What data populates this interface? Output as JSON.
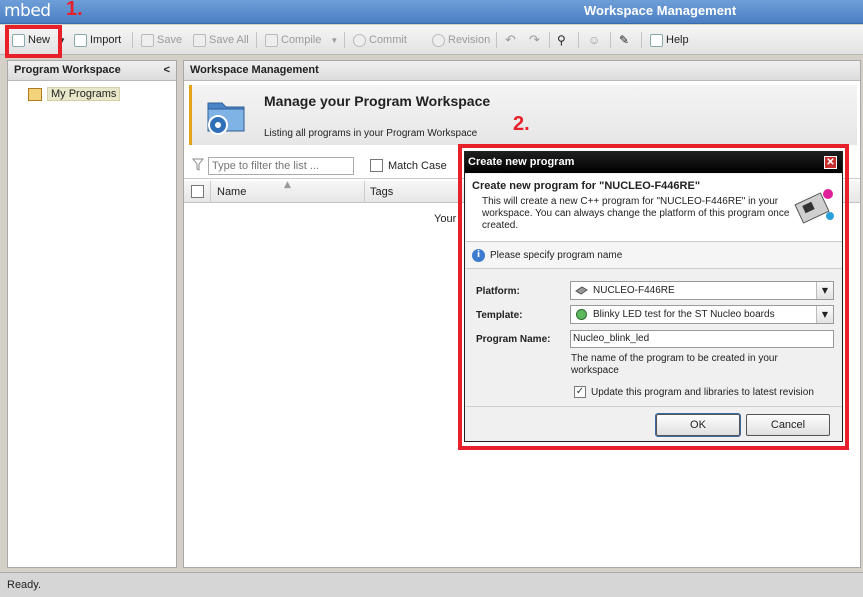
{
  "app": {
    "logo": "mbed",
    "window_title": "Workspace Management"
  },
  "annotations": {
    "step1": "1.",
    "step2": "2."
  },
  "toolbar": {
    "new": "New",
    "import": "Import",
    "save": "Save",
    "save_all": "Save All",
    "compile": "Compile",
    "commit": "Commit",
    "revision": "Revision",
    "help": "Help"
  },
  "sidebar": {
    "title": "Program Workspace",
    "collapse": "<",
    "items": [
      {
        "label": "My Programs"
      }
    ]
  },
  "main": {
    "title": "Workspace Management",
    "banner_title": "Manage your Program Workspace",
    "banner_subtitle": "Listing all programs in your Program Workspace",
    "filter_placeholder": "Type to filter the list ...",
    "match_case": "Match Case",
    "columns": [
      "Name",
      "Tags"
    ],
    "bg_text": "Your"
  },
  "status": {
    "text": "Ready."
  },
  "dialog": {
    "title": "Create new program",
    "close": "✕",
    "heading": "Create new program for \"NUCLEO-F446RE\"",
    "description": "This will create a new C++ program for \"NUCLEO-F446RE\" in your workspace. You can always change the platform of this program once created.",
    "info": "Please specify program name",
    "platform_label": "Platform:",
    "platform_value": "NUCLEO-F446RE",
    "template_label": "Template:",
    "template_value": "Blinky LED test for the ST Nucleo boards",
    "program_name_label": "Program Name:",
    "program_name_value": "Nucleo_blink_led",
    "hint": "The name of the program to be created in your workspace",
    "update_label": "Update this program and libraries to latest revision",
    "update_checked": true,
    "ok": "OK",
    "cancel": "Cancel"
  },
  "colors": {
    "annotation": "#e8202a",
    "titlebar": "#5a8ccf",
    "banner_accent": "#e5a21d"
  }
}
